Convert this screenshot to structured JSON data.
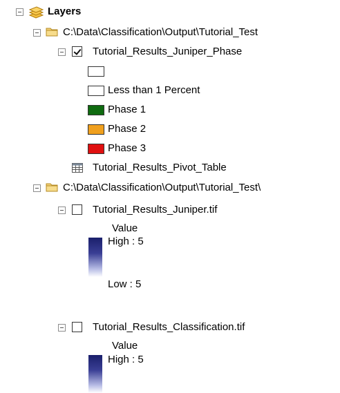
{
  "toc": {
    "root_label": "Layers",
    "group1": {
      "path": "C:\\Data\\Classification\\Output\\Tutorial_Test",
      "layer": {
        "name": "Tutorial_Results_Juniper_Phase",
        "checked": true,
        "legend": [
          {
            "label": "",
            "color": "#ffffff"
          },
          {
            "label": "Less than 1 Percent",
            "color": "#ffffff"
          },
          {
            "label": "Phase 1",
            "color": "#0f6b10"
          },
          {
            "label": "Phase 2",
            "color": "#f0a01e"
          },
          {
            "label": "Phase 3",
            "color": "#e01010"
          }
        ]
      },
      "table": {
        "name": "Tutorial_Results_Pivot_Table"
      }
    },
    "group2": {
      "path": "C:\\Data\\Classification\\Output\\Tutorial_Test\\",
      "layer1": {
        "name": "Tutorial_Results_Juniper.tif",
        "checked": false,
        "legend_title": "Value",
        "high_label": "High : 5",
        "low_label": "Low : 5"
      },
      "layer2": {
        "name": "Tutorial_Results_Classification.tif",
        "checked": false,
        "legend_title": "Value",
        "high_label": "High : 5"
      }
    }
  },
  "icons": {
    "layers": "layers-icon",
    "folder": "folder-icon",
    "table": "table-icon",
    "collapse": "collapse-icon"
  }
}
